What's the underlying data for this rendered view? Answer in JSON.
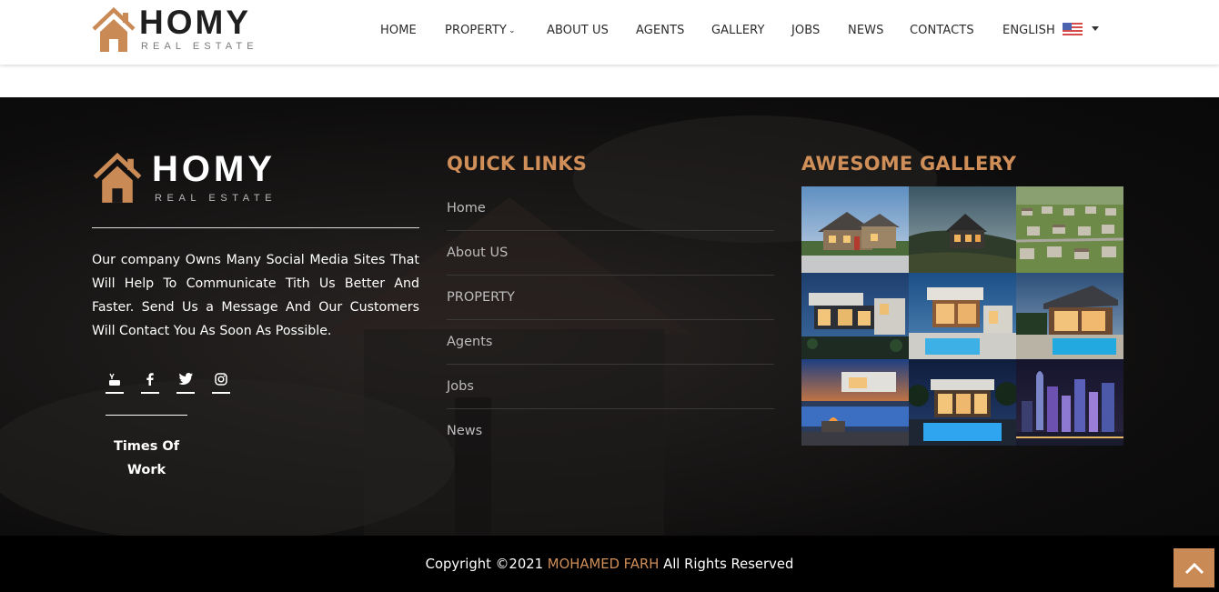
{
  "header": {
    "brand": {
      "name": "HOMY",
      "tagline": "REAL ESTATE",
      "icon": "house-logo-icon"
    },
    "nav": [
      {
        "label": "HOME"
      },
      {
        "label": "PROPERTY",
        "icon": "chevron-down-icon"
      },
      {
        "label": "ABOUT US"
      },
      {
        "label": "AGENTS"
      },
      {
        "label": "GALLERY"
      },
      {
        "label": "JOBS"
      },
      {
        "label": "NEWS"
      },
      {
        "label": "CONTACTS"
      }
    ],
    "language": {
      "label": "ENGLISH",
      "flag": "us-flag-icon",
      "icon": "caret-down-icon"
    }
  },
  "footer": {
    "brand": {
      "name": "HOMY",
      "tagline": "REAL ESTATE"
    },
    "about": "Our company Owns Many Social Media Sites That Will Help To Communicate Tith Us Better And Faster. Send Us a Message And Our Customers Will Contact You As Soon As Possible.",
    "socials": [
      "youtube-icon",
      "facebook-icon",
      "twitter-icon",
      "instagram-icon"
    ],
    "times_title": "Times Of Work",
    "quick_links": {
      "title": "QUICK LINKS",
      "items": [
        "Home",
        "About US",
        "PROPERTY",
        "Agents",
        "Jobs",
        "News"
      ]
    },
    "gallery": {
      "title": "AWESOME GALLERY",
      "images": [
        "house-dusk-photo",
        "hillside-house-photo",
        "suburb-aerial-photo",
        "modern-villa-night-photo",
        "modern-house-pool-photo",
        "villa-pool-photo",
        "infinity-pool-photo",
        "pool-villa-night-photo",
        "city-skyline-photo"
      ]
    },
    "copyright": {
      "prefix": "Copyright ©2021",
      "author": "MOHAMED FARH",
      "suffix": "All Rights Reserved"
    },
    "back_to_top_icon": "chevron-up-icon"
  },
  "colors": {
    "accent": "#d08f58",
    "footer_bg": "#121111",
    "bar_bg": "#000000"
  }
}
